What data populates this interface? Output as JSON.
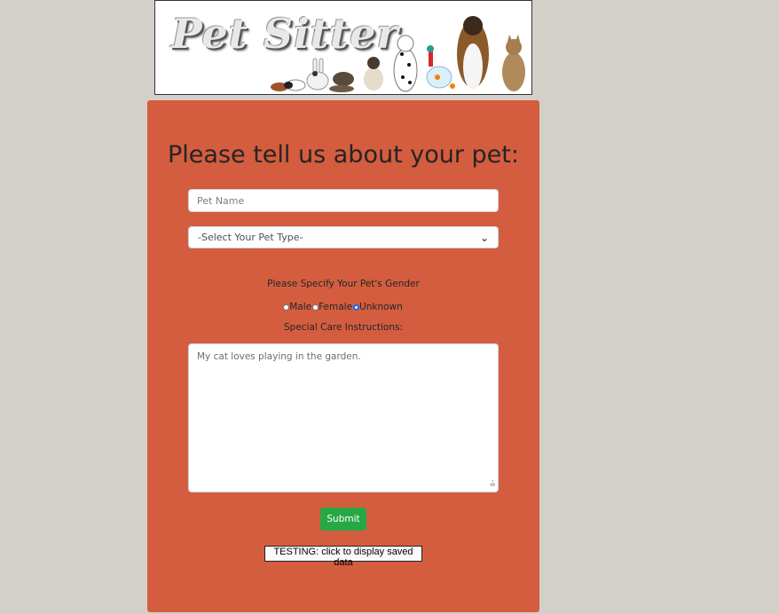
{
  "banner": {
    "logo_text": "Pet Sitter"
  },
  "form": {
    "heading": "Please tell us about your pet:",
    "pet_name_placeholder": "Pet Name",
    "pet_type_selected": "-Select Your Pet Type-",
    "gender_label": "Please Specify Your Pet's Gender",
    "gender_options": [
      "Male",
      "Female",
      "Unknown"
    ],
    "gender_selected": "Unknown",
    "care_label": "Special Care Instructions:",
    "care_value": "My cat loves playing in the garden.",
    "submit_label": "Submit",
    "testing_label": "TESTING: click to display saved data"
  }
}
